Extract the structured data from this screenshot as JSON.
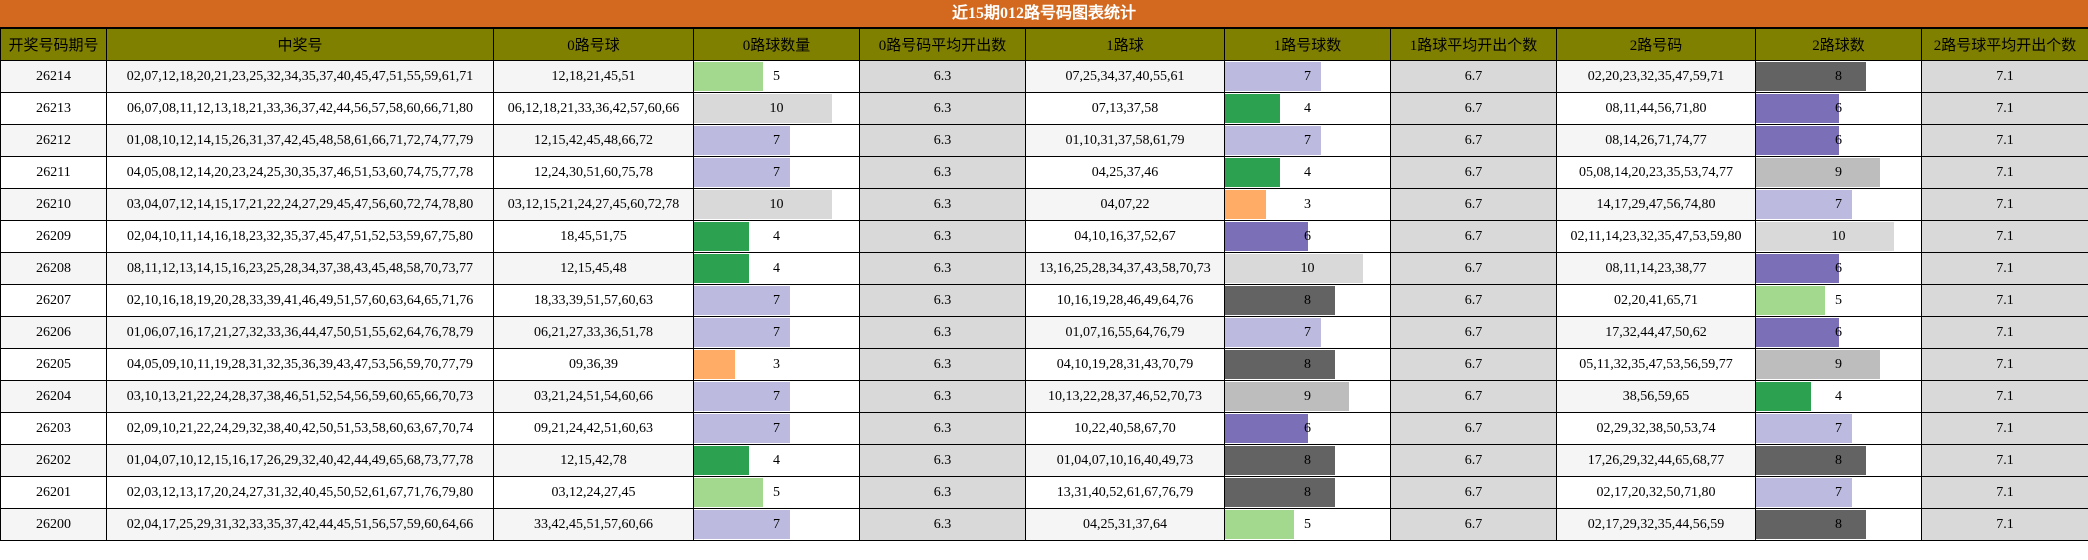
{
  "title": "近15期012路号码图表统计",
  "headers": [
    "开奖号码期号",
    "中奖号",
    "0路号球",
    "0路球数量",
    "0路号码平均开出数",
    "1路球",
    "1路号球数",
    "1路球平均开出个数",
    "2路号码",
    "2路球数",
    "2路号球平均开出个数"
  ],
  "max_count": 12,
  "colors": {
    "3": "#ffad66",
    "4": "#2ca14f",
    "5": "#a3d98f",
    "6": "#7b70b8",
    "7": "#bcbbdf",
    "8": "#636363",
    "9": "#bdbdbd",
    "10": "#d9d9d9"
  },
  "rows": [
    {
      "issue": "26214",
      "numbers": "02,07,12,18,20,21,23,25,32,34,35,37,40,45,47,51,55,59,61,71",
      "r0": "12,18,21,45,51",
      "r0_count": 5,
      "r0_avg": "6.3",
      "r1": "07,25,34,37,40,55,61",
      "r1_count": 7,
      "r1_avg": "6.7",
      "r2": "02,20,23,32,35,47,59,71",
      "r2_count": 8,
      "r2_avg": "7.1"
    },
    {
      "issue": "26213",
      "numbers": "06,07,08,11,12,13,18,21,33,36,37,42,44,56,57,58,60,66,71,80",
      "r0": "06,12,18,21,33,36,42,57,60,66",
      "r0_count": 10,
      "r0_avg": "6.3",
      "r1": "07,13,37,58",
      "r1_count": 4,
      "r1_avg": "6.7",
      "r2": "08,11,44,56,71,80",
      "r2_count": 6,
      "r2_avg": "7.1"
    },
    {
      "issue": "26212",
      "numbers": "01,08,10,12,14,15,26,31,37,42,45,48,58,61,66,71,72,74,77,79",
      "r0": "12,15,42,45,48,66,72",
      "r0_count": 7,
      "r0_avg": "6.3",
      "r1": "01,10,31,37,58,61,79",
      "r1_count": 7,
      "r1_avg": "6.7",
      "r2": "08,14,26,71,74,77",
      "r2_count": 6,
      "r2_avg": "7.1"
    },
    {
      "issue": "26211",
      "numbers": "04,05,08,12,14,20,23,24,25,30,35,37,46,51,53,60,74,75,77,78",
      "r0": "12,24,30,51,60,75,78",
      "r0_count": 7,
      "r0_avg": "6.3",
      "r1": "04,25,37,46",
      "r1_count": 4,
      "r1_avg": "6.7",
      "r2": "05,08,14,20,23,35,53,74,77",
      "r2_count": 9,
      "r2_avg": "7.1"
    },
    {
      "issue": "26210",
      "numbers": "03,04,07,12,14,15,17,21,22,24,27,29,45,47,56,60,72,74,78,80",
      "r0": "03,12,15,21,24,27,45,60,72,78",
      "r0_count": 10,
      "r0_avg": "6.3",
      "r1": "04,07,22",
      "r1_count": 3,
      "r1_avg": "6.7",
      "r2": "14,17,29,47,56,74,80",
      "r2_count": 7,
      "r2_avg": "7.1"
    },
    {
      "issue": "26209",
      "numbers": "02,04,10,11,14,16,18,23,32,35,37,45,47,51,52,53,59,67,75,80",
      "r0": "18,45,51,75",
      "r0_count": 4,
      "r0_avg": "6.3",
      "r1": "04,10,16,37,52,67",
      "r1_count": 6,
      "r1_avg": "6.7",
      "r2": "02,11,14,23,32,35,47,53,59,80",
      "r2_count": 10,
      "r2_avg": "7.1"
    },
    {
      "issue": "26208",
      "numbers": "08,11,12,13,14,15,16,23,25,28,34,37,38,43,45,48,58,70,73,77",
      "r0": "12,15,45,48",
      "r0_count": 4,
      "r0_avg": "6.3",
      "r1": "13,16,25,28,34,37,43,58,70,73",
      "r1_count": 10,
      "r1_avg": "6.7",
      "r2": "08,11,14,23,38,77",
      "r2_count": 6,
      "r2_avg": "7.1"
    },
    {
      "issue": "26207",
      "numbers": "02,10,16,18,19,20,28,33,39,41,46,49,51,57,60,63,64,65,71,76",
      "r0": "18,33,39,51,57,60,63",
      "r0_count": 7,
      "r0_avg": "6.3",
      "r1": "10,16,19,28,46,49,64,76",
      "r1_count": 8,
      "r1_avg": "6.7",
      "r2": "02,20,41,65,71",
      "r2_count": 5,
      "r2_avg": "7.1"
    },
    {
      "issue": "26206",
      "numbers": "01,06,07,16,17,21,27,32,33,36,44,47,50,51,55,62,64,76,78,79",
      "r0": "06,21,27,33,36,51,78",
      "r0_count": 7,
      "r0_avg": "6.3",
      "r1": "01,07,16,55,64,76,79",
      "r1_count": 7,
      "r1_avg": "6.7",
      "r2": "17,32,44,47,50,62",
      "r2_count": 6,
      "r2_avg": "7.1"
    },
    {
      "issue": "26205",
      "numbers": "04,05,09,10,11,19,28,31,32,35,36,39,43,47,53,56,59,70,77,79",
      "r0": "09,36,39",
      "r0_count": 3,
      "r0_avg": "6.3",
      "r1": "04,10,19,28,31,43,70,79",
      "r1_count": 8,
      "r1_avg": "6.7",
      "r2": "05,11,32,35,47,53,56,59,77",
      "r2_count": 9,
      "r2_avg": "7.1"
    },
    {
      "issue": "26204",
      "numbers": "03,10,13,21,22,24,28,37,38,46,51,52,54,56,59,60,65,66,70,73",
      "r0": "03,21,24,51,54,60,66",
      "r0_count": 7,
      "r0_avg": "6.3",
      "r1": "10,13,22,28,37,46,52,70,73",
      "r1_count": 9,
      "r1_avg": "6.7",
      "r2": "38,56,59,65",
      "r2_count": 4,
      "r2_avg": "7.1"
    },
    {
      "issue": "26203",
      "numbers": "02,09,10,21,22,24,29,32,38,40,42,50,51,53,58,60,63,67,70,74",
      "r0": "09,21,24,42,51,60,63",
      "r0_count": 7,
      "r0_avg": "6.3",
      "r1": "10,22,40,58,67,70",
      "r1_count": 6,
      "r1_avg": "6.7",
      "r2": "02,29,32,38,50,53,74",
      "r2_count": 7,
      "r2_avg": "7.1"
    },
    {
      "issue": "26202",
      "numbers": "01,04,07,10,12,15,16,17,26,29,32,40,42,44,49,65,68,73,77,78",
      "r0": "12,15,42,78",
      "r0_count": 4,
      "r0_avg": "6.3",
      "r1": "01,04,07,10,16,40,49,73",
      "r1_count": 8,
      "r1_avg": "6.7",
      "r2": "17,26,29,32,44,65,68,77",
      "r2_count": 8,
      "r2_avg": "7.1"
    },
    {
      "issue": "26201",
      "numbers": "02,03,12,13,17,20,24,27,31,32,40,45,50,52,61,67,71,76,79,80",
      "r0": "03,12,24,27,45",
      "r0_count": 5,
      "r0_avg": "6.3",
      "r1": "13,31,40,52,61,67,76,79",
      "r1_count": 8,
      "r1_avg": "6.7",
      "r2": "02,17,20,32,50,71,80",
      "r2_count": 7,
      "r2_avg": "7.1"
    },
    {
      "issue": "26200",
      "numbers": "02,04,17,25,29,31,32,33,35,37,42,44,45,51,56,57,59,60,64,66",
      "r0": "33,42,45,51,57,60,66",
      "r0_count": 7,
      "r0_avg": "6.3",
      "r1": "04,25,31,37,64",
      "r1_count": 5,
      "r1_avg": "6.7",
      "r2": "02,17,29,32,35,44,56,59",
      "r2_count": 8,
      "r2_avg": "7.1"
    }
  ]
}
